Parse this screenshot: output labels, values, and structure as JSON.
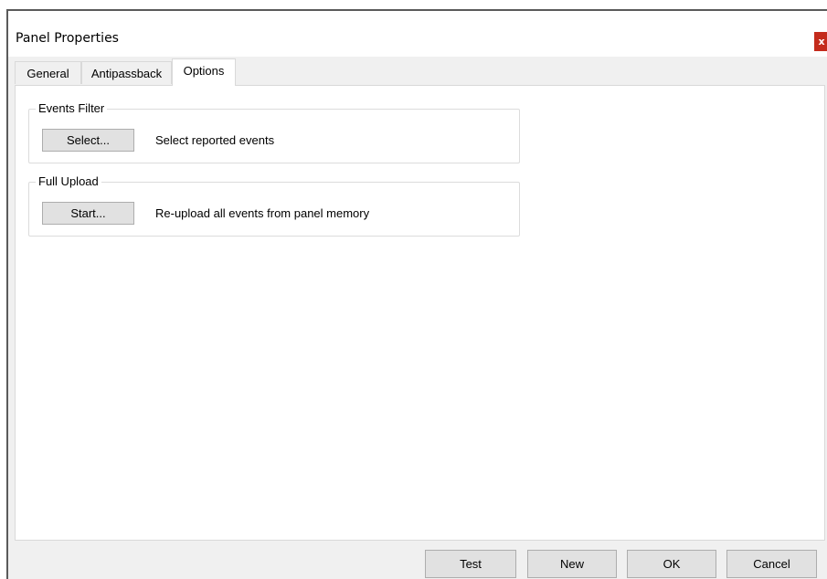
{
  "window": {
    "title": "Panel Properties",
    "close_label": "x"
  },
  "tabs": [
    {
      "label": "General",
      "active": false
    },
    {
      "label": "Antipassback",
      "active": false
    },
    {
      "label": "Options",
      "active": true
    }
  ],
  "options": {
    "events_filter": {
      "legend": "Events Filter",
      "button_label": "Select...",
      "description": "Select reported events"
    },
    "full_upload": {
      "legend": "Full Upload",
      "button_label": "Start...",
      "description": "Re-upload all events from panel memory"
    }
  },
  "footer": {
    "test_label": "Test",
    "new_label": "New",
    "ok_label": "OK",
    "cancel_label": "Cancel"
  },
  "colors": {
    "dialog_bg": "#f0f0f0",
    "panel_bg": "#ffffff",
    "close_button": "#c42b1c",
    "button_face": "#e1e1e1"
  }
}
